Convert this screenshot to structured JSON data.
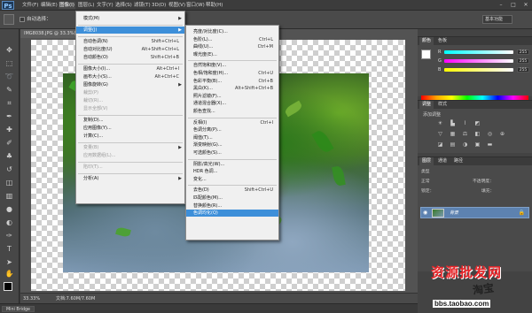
{
  "app": {
    "logo": "Ps"
  },
  "menubar": {
    "items": [
      "文件(F)",
      "编辑(E)",
      "图像(I)",
      "图层(L)",
      "文字(Y)",
      "选择(S)",
      "滤镜(T)",
      "3D(D)",
      "视图(V)",
      "窗口(W)",
      "帮助(H)"
    ]
  },
  "options": {
    "auto_select": "自动选择：",
    "workspace": "基本功能"
  },
  "document": {
    "tab": "IMG8038.JPG @ 33.3%(RGB/8)",
    "zoom": "33.33%",
    "info": "文档:7.60M/7.60M"
  },
  "minibridge": "Mini Bridge",
  "image_menu": {
    "items": [
      {
        "label": "模式(M)",
        "arrow": true
      },
      {
        "sep": true
      },
      {
        "label": "调整(J)",
        "arrow": true,
        "hl": true
      },
      {
        "sep": true
      },
      {
        "label": "自动色调(N)",
        "shortcut": "Shift+Ctrl+L"
      },
      {
        "label": "自动对比度(U)",
        "shortcut": "Alt+Shift+Ctrl+L"
      },
      {
        "label": "自动颜色(O)",
        "shortcut": "Shift+Ctrl+B"
      },
      {
        "sep": true
      },
      {
        "label": "图像大小(I)...",
        "shortcut": "Alt+Ctrl+I"
      },
      {
        "label": "画布大小(S)...",
        "shortcut": "Alt+Ctrl+C"
      },
      {
        "label": "图像旋转(G)",
        "arrow": true
      },
      {
        "label": "裁剪(P)",
        "dis": true
      },
      {
        "label": "裁切(R)...",
        "dis": true
      },
      {
        "label": "显示全部(V)",
        "dis": true
      },
      {
        "sep": true
      },
      {
        "label": "复制(D)..."
      },
      {
        "label": "应用图像(Y)..."
      },
      {
        "label": "计算(C)..."
      },
      {
        "sep": true
      },
      {
        "label": "变量(B)",
        "arrow": true,
        "dis": true
      },
      {
        "label": "应用数据组(L)...",
        "dis": true
      },
      {
        "sep": true
      },
      {
        "label": "陷印(T)...",
        "dis": true
      },
      {
        "sep": true
      },
      {
        "label": "分析(A)",
        "arrow": true
      }
    ]
  },
  "adjust_menu": {
    "items": [
      {
        "label": "亮度/对比度(C)..."
      },
      {
        "label": "色阶(L)...",
        "shortcut": "Ctrl+L"
      },
      {
        "label": "曲线(U)...",
        "shortcut": "Ctrl+M"
      },
      {
        "label": "曝光度(E)..."
      },
      {
        "sep": true
      },
      {
        "label": "自然饱和度(V)..."
      },
      {
        "label": "色相/饱和度(H)...",
        "shortcut": "Ctrl+U"
      },
      {
        "label": "色彩平衡(B)...",
        "shortcut": "Ctrl+B"
      },
      {
        "label": "黑白(K)...",
        "shortcut": "Alt+Shift+Ctrl+B"
      },
      {
        "label": "照片滤镜(F)..."
      },
      {
        "label": "通道混合器(X)..."
      },
      {
        "label": "颜色查找..."
      },
      {
        "sep": true
      },
      {
        "label": "反相(I)",
        "shortcut": "Ctrl+I"
      },
      {
        "label": "色调分离(P)..."
      },
      {
        "label": "阈值(T)..."
      },
      {
        "label": "渐变映射(G)..."
      },
      {
        "label": "可选颜色(S)..."
      },
      {
        "sep": true
      },
      {
        "label": "阴影/高光(W)..."
      },
      {
        "label": "HDR 色调..."
      },
      {
        "label": "变化..."
      },
      {
        "sep": true
      },
      {
        "label": "去色(D)",
        "shortcut": "Shift+Ctrl+U"
      },
      {
        "label": "匹配颜色(M)..."
      },
      {
        "label": "替换颜色(R)..."
      },
      {
        "label": "色调均化(Q)",
        "hl": true
      }
    ]
  },
  "panels": {
    "color_tabs": [
      "颜色",
      "色板"
    ],
    "rgb": [
      {
        "c": "R",
        "v": "255"
      },
      {
        "c": "G",
        "v": "255"
      },
      {
        "c": "B",
        "v": "255"
      }
    ],
    "adj_tabs": [
      "调整",
      "样式"
    ],
    "adj_title": "添加调整",
    "layer_tabs": [
      "图层",
      "通道",
      "路径"
    ],
    "layer_rows": [
      "类型",
      "正常",
      "锁定："
    ],
    "layer_labels": [
      "不透明度：",
      "填充："
    ],
    "layer_name": "背景"
  },
  "watermark": {
    "line1": "资源批发网",
    "line2": "淘宝",
    "url": "bbs.taobao.com"
  }
}
